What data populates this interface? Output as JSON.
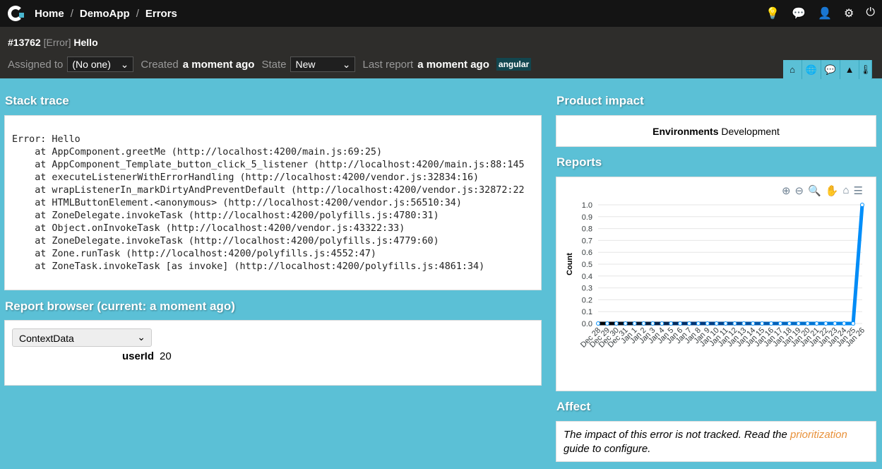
{
  "breadcrumb": [
    "Home",
    "DemoApp",
    "Errors"
  ],
  "top_icons": [
    "lightbulb-icon",
    "chat-icon",
    "user-icon",
    "gear-icon",
    "power-icon"
  ],
  "issue": {
    "id": "#13762",
    "kind": "[Error]",
    "message": "Hello"
  },
  "meta": {
    "assigned_label": "Assigned to",
    "assigned_value": "(No one)",
    "created_label": "Created",
    "created_value": "a moment ago",
    "state_label": "State",
    "state_value": "New",
    "last_report_label": "Last report",
    "last_report_value": "a moment ago",
    "tag": "angular"
  },
  "stack": {
    "title": "Stack trace",
    "text": "Error: Hello\n    at AppComponent.greetMe (http://localhost:4200/main.js:69:25)\n    at AppComponent_Template_button_click_5_listener (http://localhost:4200/main.js:88:145\n    at executeListenerWithErrorHandling (http://localhost:4200/vendor.js:32834:16)\n    at wrapListenerIn_markDirtyAndPreventDefault (http://localhost:4200/vendor.js:32872:22\n    at HTMLButtonElement.<anonymous> (http://localhost:4200/vendor.js:56510:34)\n    at ZoneDelegate.invokeTask (http://localhost:4200/polyfills.js:4780:31)\n    at Object.onInvokeTask (http://localhost:4200/vendor.js:43322:33)\n    at ZoneDelegate.invokeTask (http://localhost:4200/polyfills.js:4779:60)\n    at Zone.runTask (http://localhost:4200/polyfills.js:4552:47)\n    at ZoneTask.invokeTask [as invoke] (http://localhost:4200/polyfills.js:4861:34)"
  },
  "report_browser": {
    "title": "Report browser (current: a moment ago)",
    "select": "ContextData",
    "key": "userId",
    "value": "20"
  },
  "impact": {
    "title": "Product impact",
    "env_label": "Environments",
    "env_value": "Development"
  },
  "reports": {
    "title": "Reports"
  },
  "affect": {
    "title": "Affect",
    "text1": "The impact of this error is not tracked. Read the ",
    "link": "prioritization",
    "text2": " guide to configure."
  },
  "chart_data": {
    "type": "line",
    "ylabel": "Count",
    "ylim": [
      0,
      1
    ],
    "yticks": [
      "0.0",
      "0.1",
      "0.2",
      "0.3",
      "0.4",
      "0.5",
      "0.6",
      "0.7",
      "0.8",
      "0.9",
      "1.0"
    ],
    "categories": [
      "Dec 28",
      "Dec 29",
      "Dec 30",
      "Dec 31",
      "Jan 1",
      "Jan 2",
      "Jan 3",
      "Jan 4",
      "Jan 5",
      "Jan 6",
      "Jan 7",
      "Jan 8",
      "Jan 9",
      "Jan 10",
      "Jan 11",
      "Jan 12",
      "Jan 13",
      "Jan 14",
      "Jan 15",
      "Jan 16",
      "Jan 17",
      "Jan 18",
      "Jan 19",
      "Jan 20",
      "Jan 21",
      "Jan 22",
      "Jan 23",
      "Jan 24",
      "Jan 25",
      "Jan 26"
    ],
    "values": [
      0,
      0,
      0,
      0,
      0,
      0,
      0,
      0,
      0,
      0,
      0,
      0,
      0,
      0,
      0,
      0,
      0,
      0,
      0,
      0,
      0,
      0,
      0,
      0,
      0,
      0,
      0,
      0,
      0,
      1
    ],
    "color": "#008ffb"
  }
}
